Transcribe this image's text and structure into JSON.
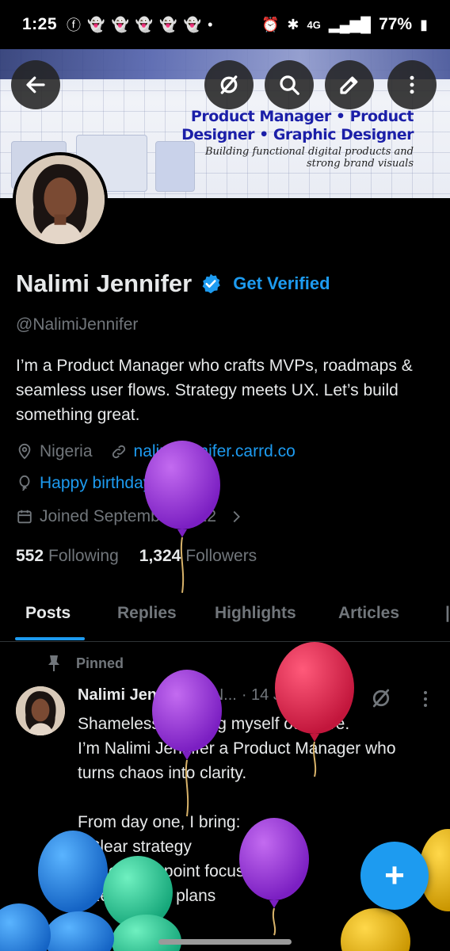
{
  "status_bar": {
    "time": "1:25",
    "battery": "77%",
    "network": "4G"
  },
  "banner": {
    "headline_line1": "Product Manager • Product",
    "headline_line2": "Designer • Graphic Designer",
    "sub_line1": "Building functional digital products and",
    "sub_line2": "strong brand visuals",
    "buttons": [
      "back-arrow-icon",
      "grok-icon",
      "search-icon",
      "edit-pencil-icon",
      "more-vertical-icon"
    ]
  },
  "profile": {
    "name": "Nalimi Jennifer",
    "get_verified": "Get Verified",
    "handle": "@NalimiJennifer",
    "bio": "I’m a Product Manager who crafts MVPs, roadmaps & seamless user flows. Strategy meets UX. Let’s build something great.",
    "location": "Nigeria",
    "website": "nalimijennifer.carrd.co",
    "birthday": "Happy birthday!",
    "joined": "Joined September 2022",
    "following_count": "552",
    "following_label": "Following",
    "followers_count": "1,324",
    "followers_label": "Followers"
  },
  "tabs": [
    "Posts",
    "Replies",
    "Highlights",
    "Articles"
  ],
  "active_tab": "Posts",
  "post": {
    "pinned_label": "Pinned",
    "author_name": "Nalimi Jennifer",
    "author_handle": "@N...",
    "date": "· 14 Jun 25",
    "text": "Shamelessly putting myself out here.\nI’m Nalimi Jennifer a Product Manager who turns chaos into clarity.\n\nFrom day one, I bring:\n• Clear strategy\n• User pain point focus\n• Real action plans"
  },
  "fab_label": "+",
  "colors": {
    "accent": "#1d9bf0",
    "background": "#000000",
    "text_primary": "#e7e9ea",
    "text_secondary": "#71767b"
  }
}
